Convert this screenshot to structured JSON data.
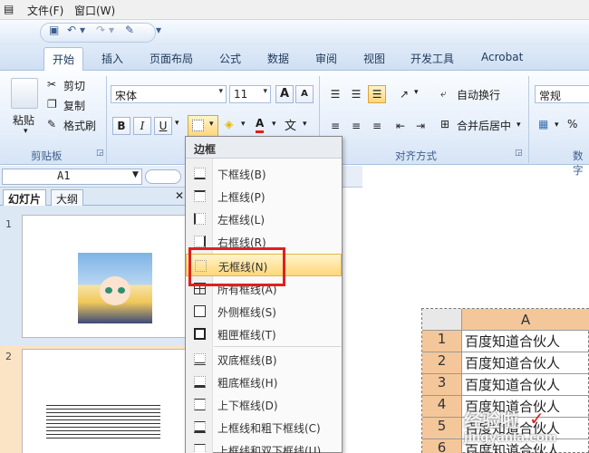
{
  "menubar": {
    "file": "文件(F)",
    "window": "窗口(W)"
  },
  "qat": {
    "save_icon": "save-icon",
    "undo_icon": "undo-icon",
    "redo_icon": "redo-icon",
    "paint_icon": "format-painter-icon",
    "more": "▾"
  },
  "tabs": [
    "开始",
    "插入",
    "页面布局",
    "公式",
    "数据",
    "审阅",
    "视图",
    "开发工具",
    "Acrobat"
  ],
  "ribbon": {
    "clipboard": {
      "paste": "粘贴",
      "cut": "剪切",
      "copy": "复制",
      "format_painter": "格式刷",
      "label": "剪贴板"
    },
    "font": {
      "name": "宋体",
      "size": "11",
      "bold": "B",
      "italic": "I",
      "underline": "U",
      "grow": "A",
      "shrink": "A",
      "font_color": "A",
      "wen": "文"
    },
    "align": {
      "wrap": "自动换行",
      "merge": "合并后居中",
      "label": "对齐方式"
    },
    "number": {
      "format": "常规",
      "label": "数字"
    }
  },
  "namebox": {
    "value": "A1"
  },
  "pane": {
    "tabs": [
      "幻灯片",
      "大纲"
    ],
    "close": "✕",
    "slides": [
      {
        "num": "1"
      },
      {
        "num": "2"
      }
    ]
  },
  "border_menu": {
    "title": "边框",
    "items": [
      {
        "label": "下框线(B)"
      },
      {
        "label": "上框线(P)"
      },
      {
        "label": "左框线(L)"
      },
      {
        "label": "右框线(R)"
      },
      {
        "label": "无框线(N)",
        "highlighted": true
      },
      {
        "label": "所有框线(A)"
      },
      {
        "label": "外侧框线(S)"
      },
      {
        "label": "粗匣框线(T)"
      },
      {
        "label": "双底框线(B)"
      },
      {
        "label": "粗底框线(H)"
      },
      {
        "label": "上下框线(D)"
      },
      {
        "label": "上框线和粗下框线(C)"
      },
      {
        "label": "上框线和双下框线(U)"
      }
    ]
  },
  "sheet": {
    "col_header": "A",
    "rows": [
      {
        "n": "1",
        "v": "百度知道合伙人"
      },
      {
        "n": "2",
        "v": "百度知道合伙人"
      },
      {
        "n": "3",
        "v": "百度知道合伙人"
      },
      {
        "n": "4",
        "v": "百度知道合伙人"
      },
      {
        "n": "5",
        "v": "百度知道合伙人"
      },
      {
        "n": "6",
        "v": "百度知道合伙人"
      }
    ]
  },
  "watermark": {
    "brand": "经验啦",
    "url": "jingyanla.com"
  },
  "colors": {
    "accent": "#1e395b",
    "highlight": "#ffd77a",
    "red_box": "#e0201e",
    "row_header": "#f4c79a"
  }
}
